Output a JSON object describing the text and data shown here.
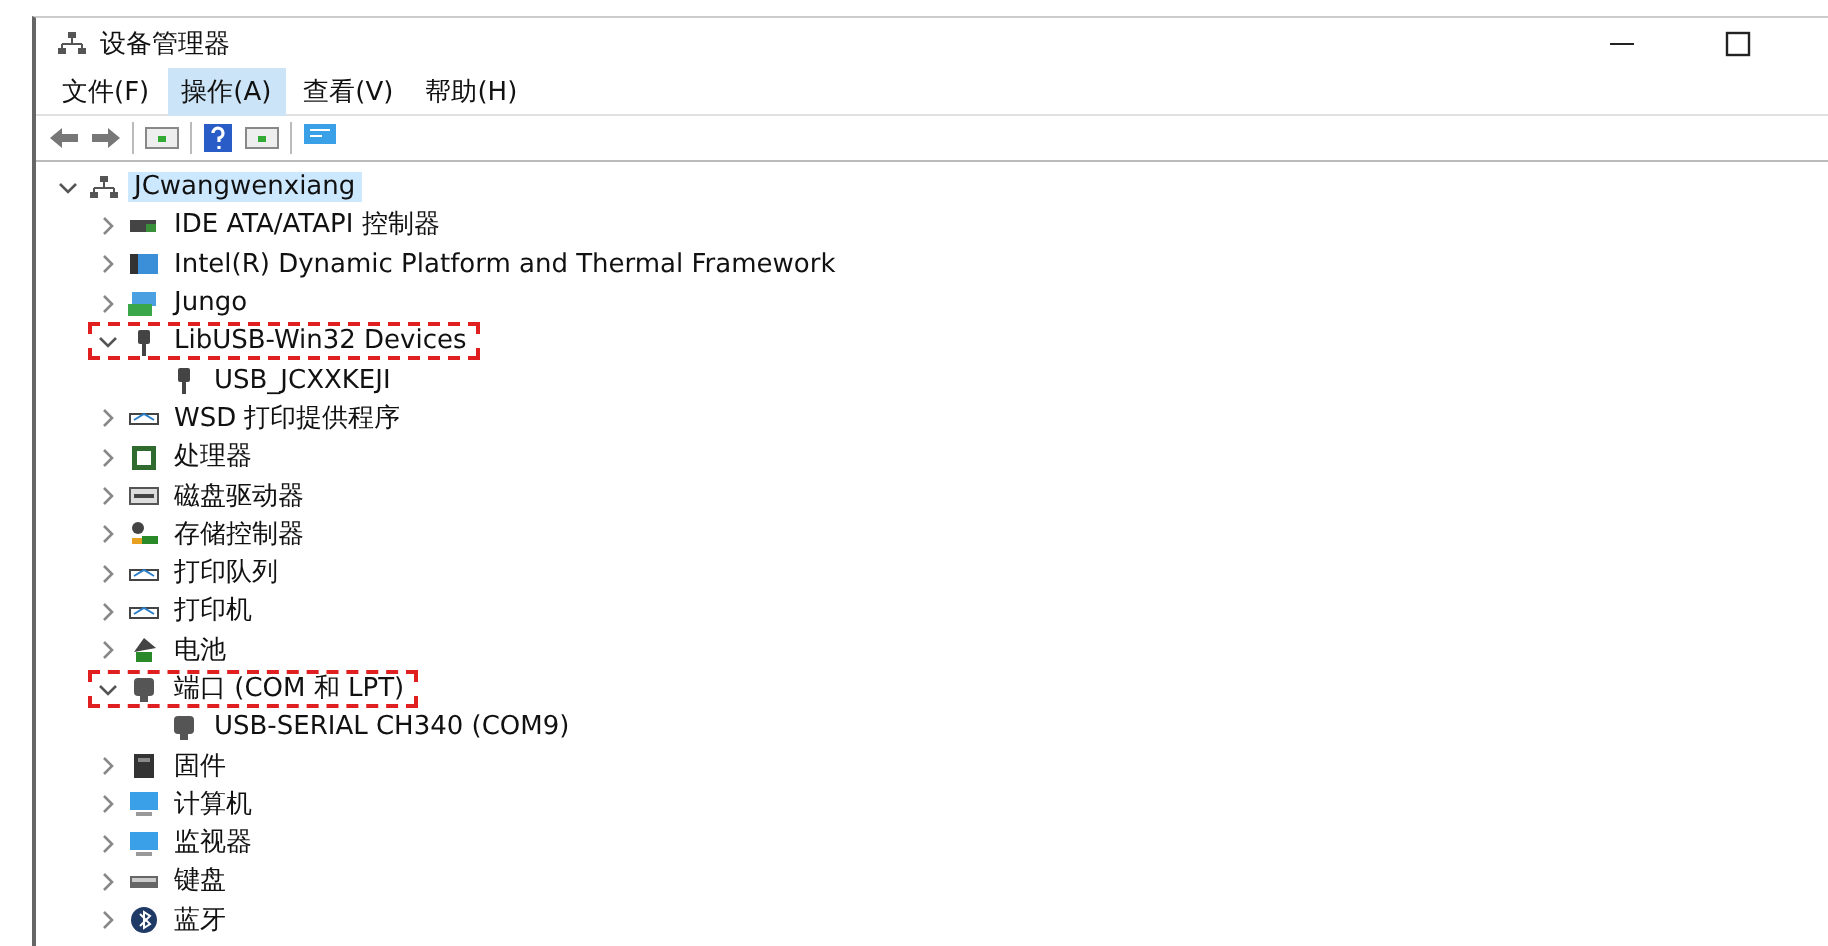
{
  "window": {
    "title": "设备管理器"
  },
  "menu": [
    {
      "label": "文件(F)",
      "selected": false
    },
    {
      "label": "操作(A)",
      "selected": true
    },
    {
      "label": "查看(V)",
      "selected": false
    },
    {
      "label": "帮助(H)",
      "selected": false
    }
  ],
  "tree": [
    {
      "label": "JCwangwenxiang",
      "kind": "network",
      "expanded": true,
      "selected": true,
      "highlighted": false,
      "children": [
        {
          "label": "IDE ATA/ATAPI 控制器",
          "kind": "chip",
          "expanded": false,
          "selected": false,
          "highlighted": false
        },
        {
          "label": "Intel(R) Dynamic Platform and Thermal Framework",
          "kind": "folder",
          "expanded": false,
          "selected": false,
          "highlighted": false
        },
        {
          "label": "Jungo",
          "kind": "jungo",
          "expanded": false,
          "selected": false,
          "highlighted": false
        },
        {
          "label": "LibUSB-Win32 Devices",
          "kind": "usb",
          "expanded": true,
          "selected": false,
          "highlighted": true,
          "children": [
            {
              "label": "USB_JCXXKEJI",
              "kind": "usb",
              "selected": false,
              "highlighted": false
            }
          ]
        },
        {
          "label": "WSD 打印提供程序",
          "kind": "printer",
          "expanded": false,
          "selected": false,
          "highlighted": false
        },
        {
          "label": "处理器",
          "kind": "cpu",
          "expanded": false,
          "selected": false,
          "highlighted": false
        },
        {
          "label": "磁盘驱动器",
          "kind": "disk",
          "expanded": false,
          "selected": false,
          "highlighted": false
        },
        {
          "label": "存储控制器",
          "kind": "storage",
          "expanded": false,
          "selected": false,
          "highlighted": false
        },
        {
          "label": "打印队列",
          "kind": "printer",
          "expanded": false,
          "selected": false,
          "highlighted": false
        },
        {
          "label": "打印机",
          "kind": "printer",
          "expanded": false,
          "selected": false,
          "highlighted": false
        },
        {
          "label": "电池",
          "kind": "battery",
          "expanded": false,
          "selected": false,
          "highlighted": false
        },
        {
          "label": "端口 (COM 和 LPT)",
          "kind": "port",
          "expanded": true,
          "selected": false,
          "highlighted": true,
          "children": [
            {
              "label": "USB-SERIAL CH340 (COM9)",
              "kind": "port",
              "selected": false,
              "highlighted": false
            }
          ]
        },
        {
          "label": "固件",
          "kind": "firmware",
          "expanded": false,
          "selected": false,
          "highlighted": false
        },
        {
          "label": "计算机",
          "kind": "computer",
          "expanded": false,
          "selected": false,
          "highlighted": false
        },
        {
          "label": "监视器",
          "kind": "computer",
          "expanded": false,
          "selected": false,
          "highlighted": false
        },
        {
          "label": "键盘",
          "kind": "keyboard",
          "expanded": false,
          "selected": false,
          "highlighted": false
        },
        {
          "label": "蓝牙",
          "kind": "bluetooth",
          "expanded": false,
          "selected": false,
          "highlighted": false
        }
      ]
    }
  ]
}
